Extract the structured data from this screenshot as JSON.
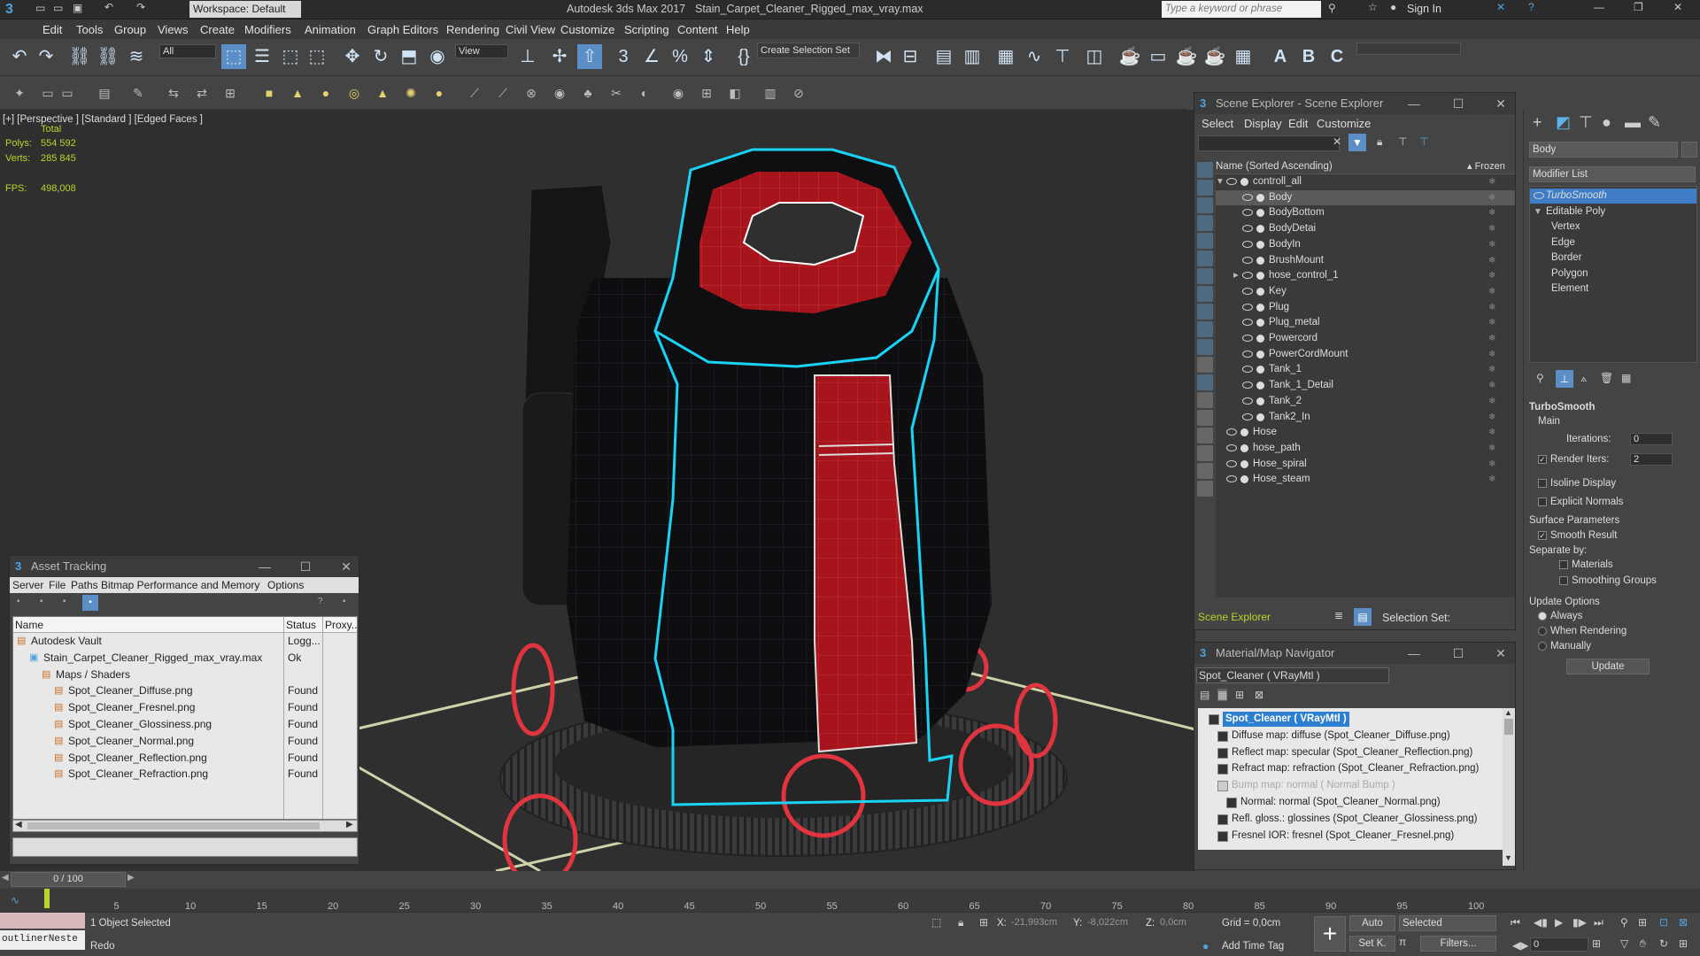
{
  "app": {
    "title": "Autodesk 3ds Max 2017",
    "file": "Stain_Carpet_Cleaner_Rigged_max_vray.max",
    "workspace": "Workspace: Default",
    "search_placeholder": "Type a keyword or phrase",
    "sign_in": "Sign In"
  },
  "menu": [
    "Edit",
    "Tools",
    "Group",
    "Views",
    "Create",
    "Modifiers",
    "Animation",
    "Graph Editors",
    "Rendering",
    "Civil View",
    "Customize",
    "Scripting",
    "Content",
    "Help"
  ],
  "toolbar": {
    "filter": "All",
    "view": "View",
    "selection_set": "Create Selection Set"
  },
  "viewport": {
    "labels": "[+] [Perspective ] [Standard ] [Edged Faces ]",
    "stats_header": "Total",
    "polys_label": "Polys:",
    "polys": "554 592",
    "verts_label": "Verts:",
    "verts": "285 845",
    "fps_label": "FPS:",
    "fps": "498,008"
  },
  "scene_explorer": {
    "title": "Scene Explorer - Scene Explorer",
    "menu": [
      "Select",
      "Display",
      "Edit",
      "Customize"
    ],
    "col_name": "Name (Sorted Ascending)",
    "col_frozen": "▴ Frozen",
    "items": [
      {
        "label": "controll_all",
        "level": 0,
        "group": true
      },
      {
        "label": "Body",
        "level": 1,
        "selected": true
      },
      {
        "label": "BodyBottom",
        "level": 1
      },
      {
        "label": "BodyDetai",
        "level": 1
      },
      {
        "label": "BodyIn",
        "level": 1
      },
      {
        "label": "BrushMount",
        "level": 1
      },
      {
        "label": "hose_control_1",
        "level": 1,
        "group": true
      },
      {
        "label": "Key",
        "level": 1
      },
      {
        "label": "Plug",
        "level": 1
      },
      {
        "label": "Plug_metal",
        "level": 1
      },
      {
        "label": "Powercord",
        "level": 1
      },
      {
        "label": "PowerCordMount",
        "level": 1
      },
      {
        "label": "Tank_1",
        "level": 1
      },
      {
        "label": "Tank_1_Detail",
        "level": 1
      },
      {
        "label": "Tank_2",
        "level": 1
      },
      {
        "label": "Tank2_In",
        "level": 1
      },
      {
        "label": "Hose",
        "level": 0
      },
      {
        "label": "hose_path",
        "level": 0
      },
      {
        "label": "Hose_spiral",
        "level": 0
      },
      {
        "label": "Hose_steam",
        "level": 0
      }
    ],
    "footer_label": "Scene Explorer",
    "selection_set": "Selection Set:"
  },
  "command_panel": {
    "object_name": "Body",
    "modifier_list": "Modifier List",
    "stack": [
      {
        "label": "TurboSmooth",
        "level": 0,
        "active": true
      },
      {
        "label": "Editable Poly",
        "level": 0
      },
      {
        "label": "Vertex",
        "level": 1
      },
      {
        "label": "Edge",
        "level": 1
      },
      {
        "label": "Border",
        "level": 1
      },
      {
        "label": "Polygon",
        "level": 1
      },
      {
        "label": "Element",
        "level": 1
      }
    ],
    "rollout": "TurboSmooth",
    "main": "Main",
    "iterations_label": "Iterations:",
    "iterations": "0",
    "render_iters_label": "Render Iters:",
    "render_iters": "2",
    "isoline": "Isoline Display",
    "explicit": "Explicit Normals",
    "surface": "Surface Parameters",
    "smooth_result": "Smooth Result",
    "separate_by": "Separate by:",
    "materials": "Materials",
    "smoothing_groups": "Smoothing Groups",
    "update_options": "Update Options",
    "always": "Always",
    "when_rendering": "When Rendering",
    "manually": "Manually",
    "update": "Update"
  },
  "asset_tracking": {
    "title": "Asset Tracking",
    "menu": [
      "Server",
      "File",
      "Paths",
      "Bitmap Performance and Memory",
      "Options"
    ],
    "col_name": "Name",
    "col_status": "Status",
    "col_proxy": "Proxy...",
    "rows": [
      {
        "name": "Autodesk Vault",
        "status": "Logg...",
        "level": 0
      },
      {
        "name": "Stain_Carpet_Cleaner_Rigged_max_vray.max",
        "status": "Ok",
        "level": 1
      },
      {
        "name": "Maps / Shaders",
        "status": "",
        "level": 2
      },
      {
        "name": "Spot_Cleaner_Diffuse.png",
        "status": "Found",
        "level": 3
      },
      {
        "name": "Spot_Cleaner_Fresnel.png",
        "status": "Found",
        "level": 3
      },
      {
        "name": "Spot_Cleaner_Glossiness.png",
        "status": "Found",
        "level": 3
      },
      {
        "name": "Spot_Cleaner_Normal.png",
        "status": "Found",
        "level": 3
      },
      {
        "name": "Spot_Cleaner_Reflection.png",
        "status": "Found",
        "level": 3
      },
      {
        "name": "Spot_Cleaner_Refraction.png",
        "status": "Found",
        "level": 3
      }
    ]
  },
  "material_navigator": {
    "title": "Material/Map Navigator",
    "material": "Spot_Cleaner  ( VRayMtl )",
    "items": [
      {
        "label": "Spot_Cleaner  ( VRayMtl )",
        "selected": true,
        "level": 0
      },
      {
        "label": "Diffuse map: diffuse (Spot_Cleaner_Diffuse.png)",
        "level": 1
      },
      {
        "label": "Reflect map: specular (Spot_Cleaner_Reflection.png)",
        "level": 1
      },
      {
        "label": "Refract map: refraction (Spot_Cleaner_Refraction.png)",
        "level": 1
      },
      {
        "label": "Bump map: normal  ( Normal Bump )",
        "level": 1,
        "dim": true
      },
      {
        "label": "Normal: normal (Spot_Cleaner_Normal.png)",
        "level": 2
      },
      {
        "label": "Refl. gloss.: glossines (Spot_Cleaner_Glossiness.png)",
        "level": 1
      },
      {
        "label": "Fresnel IOR: fresnel (Spot_Cleaner_Fresnel.png)",
        "level": 1
      }
    ]
  },
  "timeline": {
    "frame": "0 / 100",
    "ticks": [
      0,
      5,
      10,
      15,
      20,
      25,
      30,
      35,
      40,
      45,
      50,
      55,
      60,
      65,
      70,
      75,
      80,
      85,
      90,
      95,
      100
    ],
    "max": 100
  },
  "status": {
    "selected": "1 Object Selected",
    "prompt": "Redo",
    "script": "outlinerNeste",
    "x_label": "X:",
    "x": "-21,993cm",
    "y_label": "Y:",
    "y": "-8,022cm",
    "z_label": "Z:",
    "z": "0,0cm",
    "grid": "Grid = 0,0cm",
    "add_time_tag": "Add Time Tag",
    "auto": "Auto",
    "set_k": "Set K.",
    "key_mode": "Selected",
    "filters": "Filters...",
    "frame_field": "0"
  },
  "colors": {
    "accent": "#4fa3e0",
    "selected_row": "#5a5a5a",
    "highlight": "#2f7fd0",
    "green_text": "#b9d42a",
    "mesh_red": "#a8141b",
    "outline_cyan": "#19d3f5"
  }
}
